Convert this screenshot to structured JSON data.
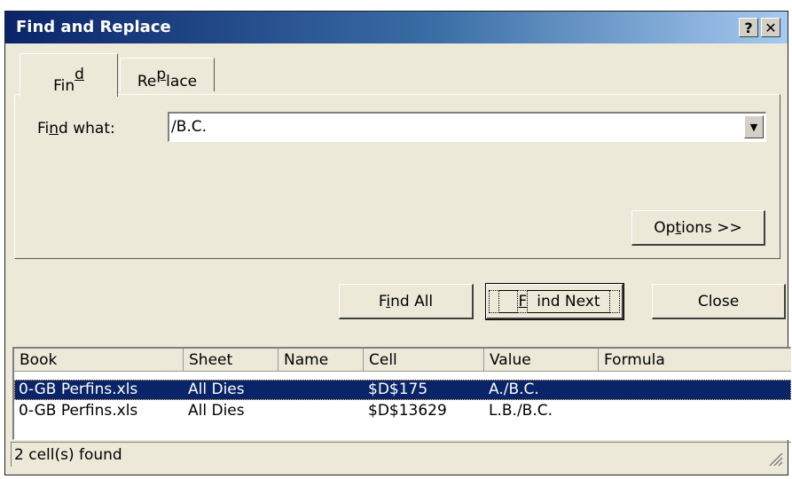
{
  "window": {
    "title": "Find and Replace",
    "help_glyph": "?",
    "close_glyph": "✕"
  },
  "tabs": [
    {
      "label_pre": "Fin",
      "label_ul": "d",
      "label_post": "",
      "active": true
    },
    {
      "label_pre": "Re",
      "label_ul": "p",
      "label_post": "lace",
      "active": false
    }
  ],
  "find": {
    "label_pre": "Fi",
    "label_ul": "n",
    "label_post": "d what:",
    "value": "/B.C."
  },
  "buttons": {
    "options": {
      "pre": "Op",
      "ul": "t",
      "post": "ions >>"
    },
    "find_all": {
      "pre": "F",
      "ul": "i",
      "post": "nd All"
    },
    "find_next": {
      "pre": "",
      "ul": "F",
      "post": "ind Next"
    },
    "close": "Close"
  },
  "results": {
    "columns": [
      "Book",
      "Sheet",
      "Name",
      "Cell",
      "Value",
      "Formula"
    ],
    "rows": [
      {
        "book": "0-GB Perfins.xls",
        "sheet": "All Dies",
        "name": "",
        "cell": "$D$175",
        "value": "A./B.C.",
        "formula": "",
        "selected": true
      },
      {
        "book": "0-GB Perfins.xls",
        "sheet": "All Dies",
        "name": "",
        "cell": "$D$13629",
        "value": "L.B./B.C.",
        "formula": "",
        "selected": false
      }
    ]
  },
  "status": "2 cell(s) found",
  "colors": {
    "selection": "#0a246a",
    "title_start": "#0a246a",
    "title_end": "#a6caf0"
  }
}
